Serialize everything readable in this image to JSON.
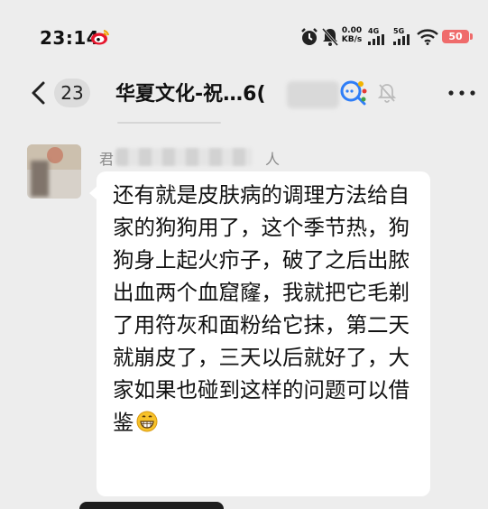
{
  "status_bar": {
    "time": "23:14",
    "net_speed_value": "0.00",
    "net_speed_unit": "KB/s",
    "signal_1_label": "4G",
    "signal_2_label": "5G",
    "battery_level": "50",
    "battery_color": "#ef6b6b",
    "icons": [
      "weibo-icon",
      "alarm-icon",
      "bell-off-icon",
      "signal-icon",
      "signal-icon",
      "wifi-icon",
      "battery-icon"
    ]
  },
  "header": {
    "unread_count": "23",
    "chat_title": "华夏文化-祝…6(",
    "icons": [
      "back-icon",
      "channels-icon",
      "mute-icon",
      "more-icon"
    ]
  },
  "message": {
    "sender_name_start": "君",
    "sender_name_end": "人",
    "text": "还有就是皮肤病的调理方法给自家的狗狗用了，这个季节热，狗狗身上起火疖子，破了之后出脓出血两个血窟窿，我就把它毛剃了用符灰和面粉给它抹，第二天就崩皮了，三天以后就好了，大家如果也碰到这样的问题可以借鉴",
    "emoji": "grin-icon"
  },
  "colors": {
    "background": "#ededed",
    "bubble": "#ffffff",
    "accent_blue": "#2f7ef7"
  }
}
